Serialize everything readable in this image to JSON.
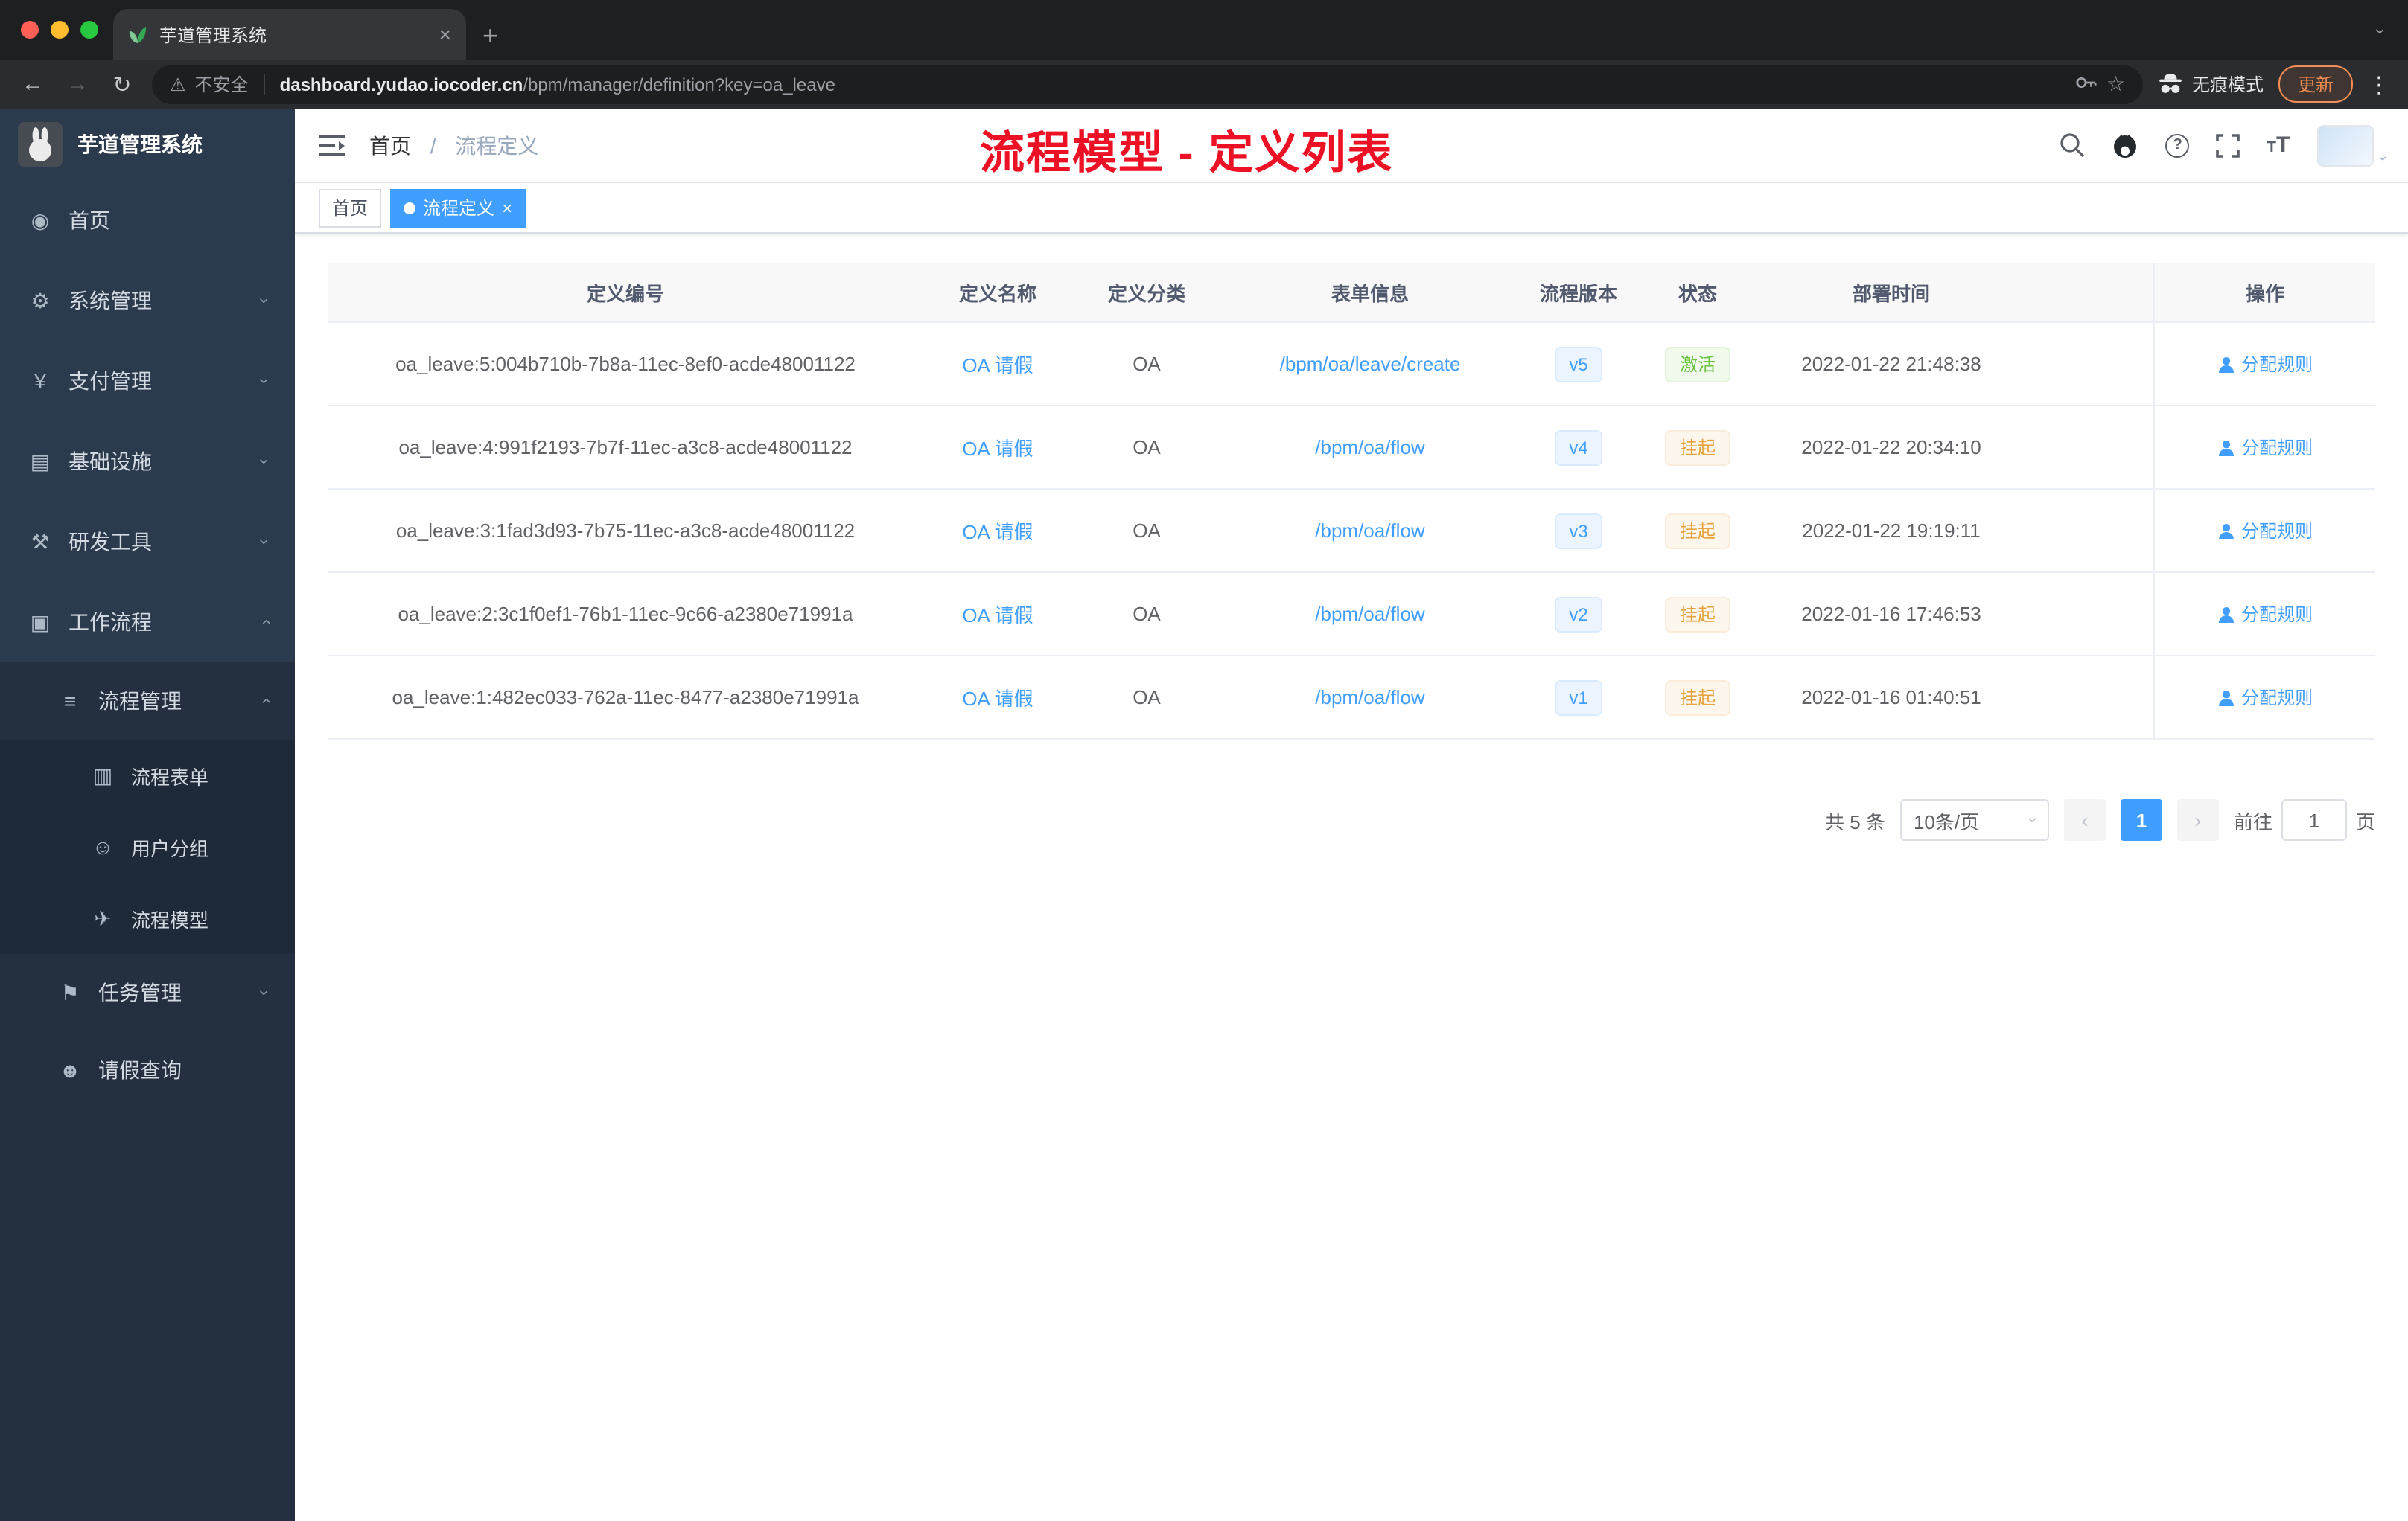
{
  "colors": {
    "accent": "#409eff",
    "success": "#67c23a",
    "warning": "#e6a23c",
    "annotation_red": "#ed1125",
    "sidebar_bg": "#2c3a4d"
  },
  "browser": {
    "tab": {
      "title": "芋道管理系统"
    },
    "toolbar": {
      "security_label": "不安全",
      "url_domain": "dashboard.yudao.iocoder.cn",
      "url_path": "/bpm/manager/definition?key=oa_leave",
      "incognito_label": "无痕模式",
      "update_label": "更新"
    }
  },
  "sidebar": {
    "title": "芋道管理系统",
    "items": [
      {
        "key": "home",
        "label": "首页",
        "icon": "dashboard-icon",
        "glyph": "◉",
        "level": 1,
        "chevron": null
      },
      {
        "key": "system",
        "label": "系统管理",
        "icon": "gear-icon",
        "glyph": "⚙",
        "level": 1,
        "chevron": "down"
      },
      {
        "key": "payment",
        "label": "支付管理",
        "icon": "payment-icon",
        "glyph": "¥",
        "level": 1,
        "chevron": "down"
      },
      {
        "key": "infrastructure",
        "label": "基础设施",
        "icon": "infrastructure-icon",
        "glyph": "▤",
        "level": 1,
        "chevron": "down"
      },
      {
        "key": "devtools",
        "label": "研发工具",
        "icon": "tools-icon",
        "glyph": "⚒",
        "level": 1,
        "chevron": "down"
      },
      {
        "key": "workflow",
        "label": "工作流程",
        "icon": "briefcase-icon",
        "glyph": "▣",
        "level": 1,
        "chevron": "up"
      },
      {
        "key": "process-manage",
        "label": "流程管理",
        "icon": "list-icon",
        "glyph": "≡",
        "level": 2,
        "chevron": "up"
      },
      {
        "key": "process-form",
        "label": "流程表单",
        "icon": "form-icon",
        "glyph": "▥",
        "level": 3,
        "chevron": null
      },
      {
        "key": "user-group",
        "label": "用户分组",
        "icon": "user-group-icon",
        "glyph": "☺",
        "level": 3,
        "chevron": null
      },
      {
        "key": "process-model",
        "label": "流程模型",
        "icon": "paper-plane-icon",
        "glyph": "✈",
        "level": 3,
        "chevron": null
      },
      {
        "key": "task-manage",
        "label": "任务管理",
        "icon": "flag-icon",
        "glyph": "⚑",
        "level": 2,
        "chevron": "down"
      },
      {
        "key": "leave-query",
        "label": "请假查询",
        "icon": "person-icon",
        "glyph": "☻",
        "level": 2,
        "chevron": null
      }
    ]
  },
  "header": {
    "breadcrumb_home": "首页",
    "breadcrumb_current": "流程定义",
    "annotation": "流程模型 - 定义列表"
  },
  "tags": {
    "first": "首页",
    "active": "流程定义"
  },
  "table": {
    "headers": [
      "定义编号",
      "定义名称",
      "定义分类",
      "表单信息",
      "流程版本",
      "状态",
      "部署时间",
      "操作"
    ],
    "rows": [
      {
        "id": "oa_leave:5:004b710b-7b8a-11ec-8ef0-acde48001122",
        "name": "OA 请假",
        "category": "OA",
        "form": "/bpm/oa/leave/create",
        "version": "v5",
        "status": "激活",
        "status_type": "success",
        "time": "2022-01-22 21:48:38",
        "action": "分配规则"
      },
      {
        "id": "oa_leave:4:991f2193-7b7f-11ec-a3c8-acde48001122",
        "name": "OA 请假",
        "category": "OA",
        "form": "/bpm/oa/flow",
        "version": "v4",
        "status": "挂起",
        "status_type": "warning",
        "time": "2022-01-22 20:34:10",
        "action": "分配规则"
      },
      {
        "id": "oa_leave:3:1fad3d93-7b75-11ec-a3c8-acde48001122",
        "name": "OA 请假",
        "category": "OA",
        "form": "/bpm/oa/flow",
        "version": "v3",
        "status": "挂起",
        "status_type": "warning",
        "time": "2022-01-22 19:19:11",
        "action": "分配规则"
      },
      {
        "id": "oa_leave:2:3c1f0ef1-76b1-11ec-9c66-a2380e71991a",
        "name": "OA 请假",
        "category": "OA",
        "form": "/bpm/oa/flow",
        "version": "v2",
        "status": "挂起",
        "status_type": "warning",
        "time": "2022-01-16 17:46:53",
        "action": "分配规则"
      },
      {
        "id": "oa_leave:1:482ec033-762a-11ec-8477-a2380e71991a",
        "name": "OA 请假",
        "category": "OA",
        "form": "/bpm/oa/flow",
        "version": "v1",
        "status": "挂起",
        "status_type": "warning",
        "time": "2022-01-16 01:40:51",
        "action": "分配规则"
      }
    ]
  },
  "pagination": {
    "total": "共 5 条",
    "page_size": "10条/页",
    "current_page": "1",
    "goto_label": "前往",
    "goto_value": "1",
    "page_unit": "页"
  }
}
